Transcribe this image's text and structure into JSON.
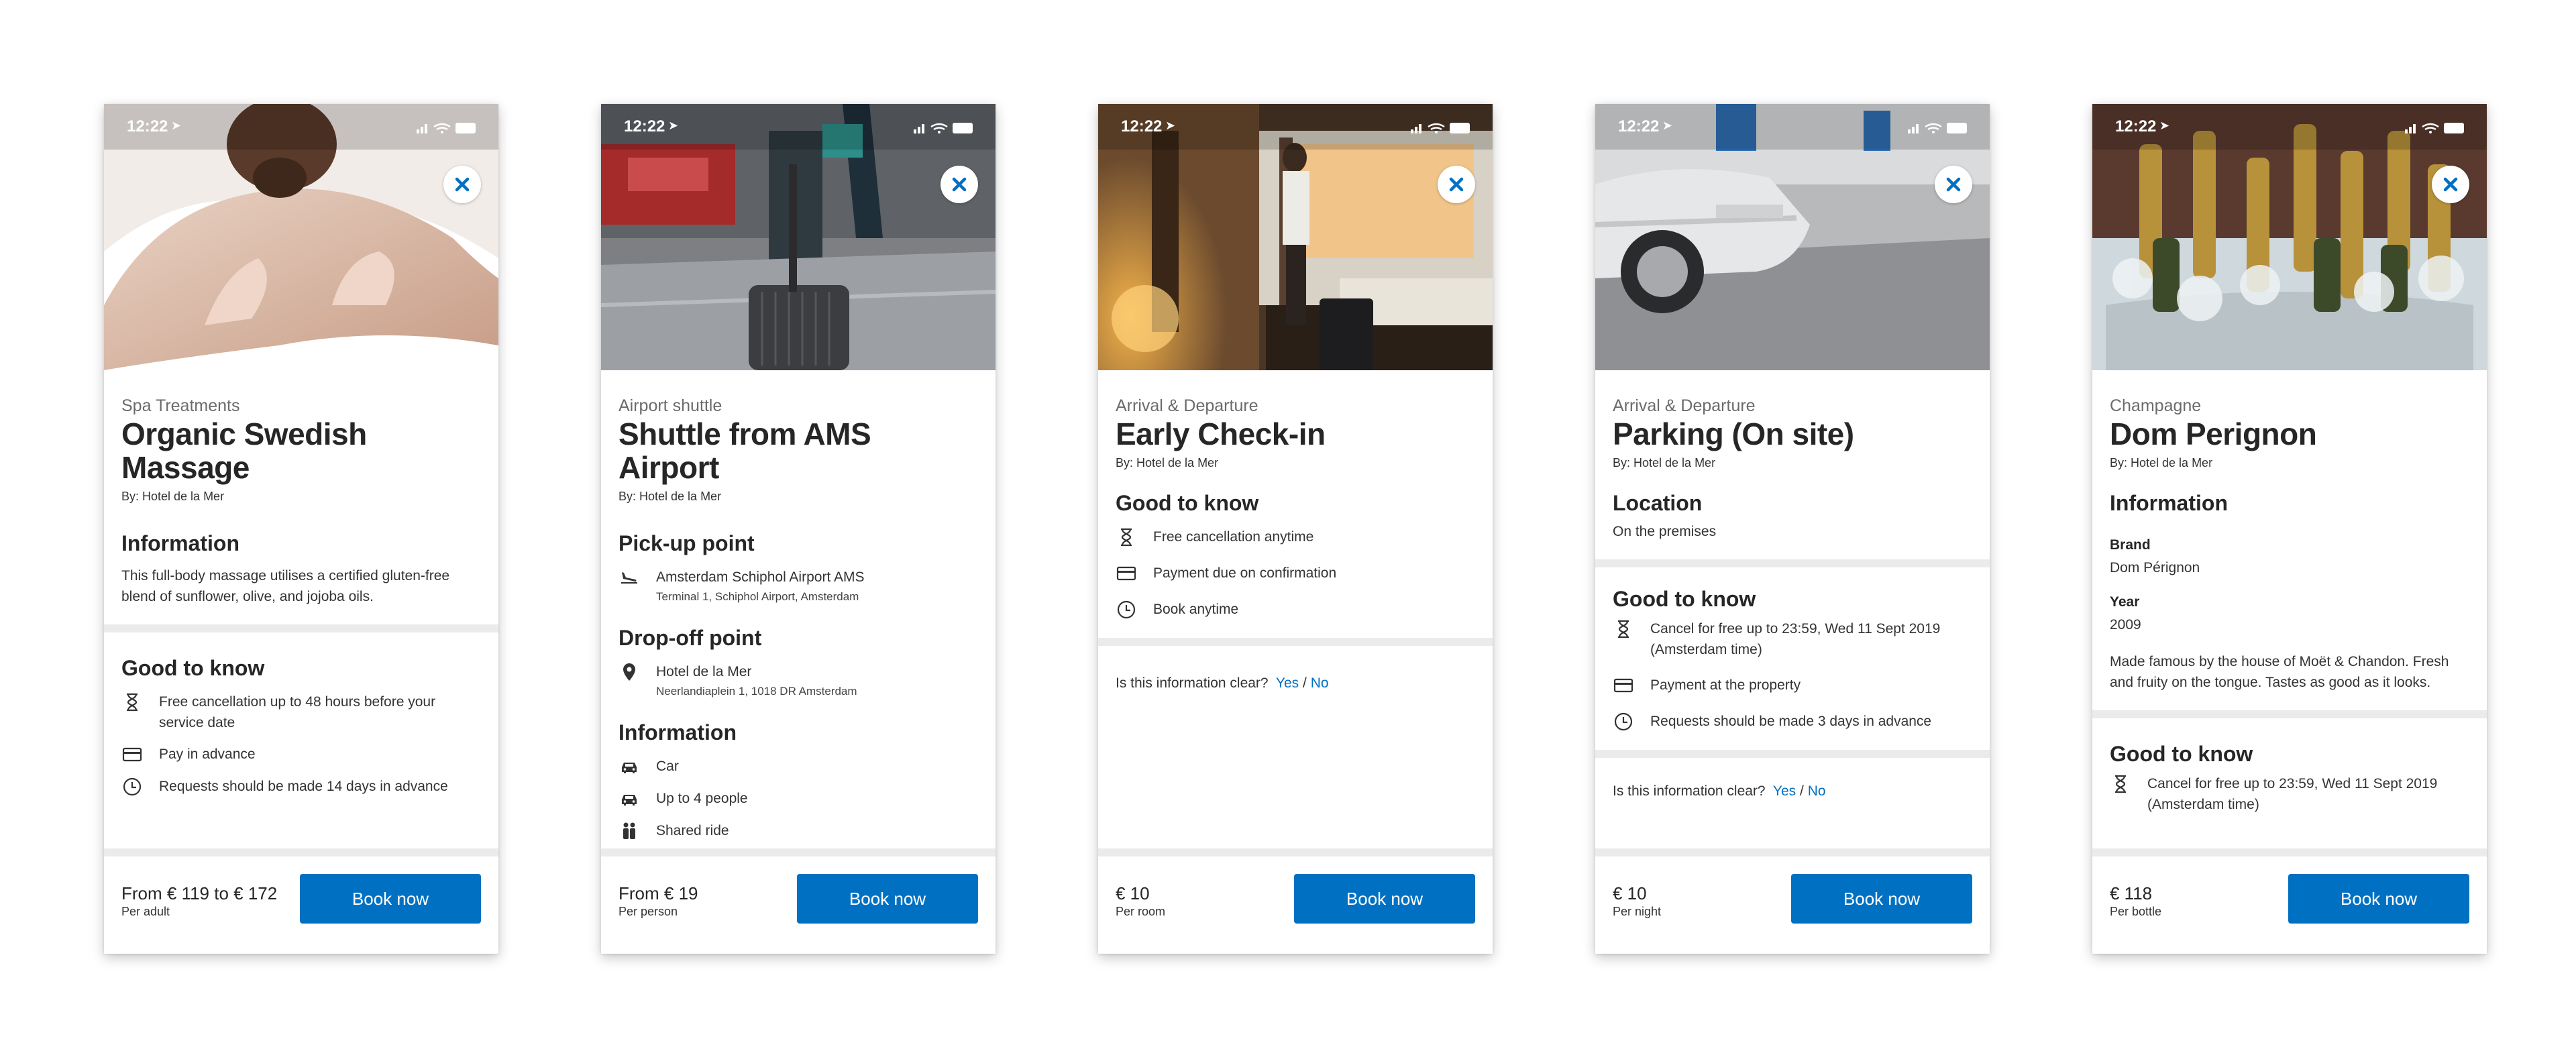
{
  "status_bar": {
    "time": "12:22"
  },
  "colors": {
    "primary": "#0071c2",
    "divider": "#ebebeb",
    "text": "#262626"
  },
  "screens": [
    {
      "category": "Spa Treatments",
      "title_line1": "Organic Swedish",
      "title_line2": "Massage",
      "by": "By: Hotel de la Mer",
      "info_heading": "Information",
      "info_text": "This full-body massage utilises a certified gluten-free blend of sunflower, olive, and jojoba oils.",
      "gtk_heading": "Good to know",
      "gtk": [
        {
          "icon": "hourglass-icon",
          "text": "Free cancellation up to 48 hours before your service date"
        },
        {
          "icon": "credit-card-icon",
          "text": "Pay in advance"
        },
        {
          "icon": "clock-icon",
          "text": "Requests should be made 14 days in advance"
        }
      ],
      "price": "From € 119 to € 172",
      "per": "Per adult",
      "button": "Book now"
    },
    {
      "category": "Airport shuttle",
      "title_line1": "Shuttle from AMS",
      "title_line2": "Airport",
      "by": "By: Hotel de la Mer",
      "pickup_heading": "Pick-up point",
      "pickup": {
        "icon": "airplane-landing-icon",
        "text": "Amsterdam Schiphol Airport AMS",
        "sub": "Terminal 1, Schiphol Airport, Amsterdam"
      },
      "dropoff_heading": "Drop-off point",
      "dropoff": {
        "icon": "map-pin-icon",
        "text": "Hotel de la Mer",
        "sub": "Neerlandiaplein 1, 1018 DR Amsterdam"
      },
      "info_heading": "Information",
      "info": [
        {
          "icon": "car-icon",
          "text": "Car"
        },
        {
          "icon": "car-icon",
          "text": "Up to 4 people"
        },
        {
          "icon": "people-icon",
          "text": "Shared ride"
        }
      ],
      "price": "From € 19",
      "per": "Per person",
      "button": "Book now"
    },
    {
      "category": "Arrival & Departure",
      "title_line1": "Early Check-in",
      "by": "By: Hotel de la Mer",
      "gtk_heading": "Good to know",
      "gtk": [
        {
          "icon": "hourglass-icon",
          "text": "Free cancellation anytime"
        },
        {
          "icon": "credit-card-icon",
          "text": "Payment due on confirmation"
        },
        {
          "icon": "clock-icon",
          "text": "Book anytime"
        }
      ],
      "clear_q": "Is this information clear?",
      "yes": "Yes",
      "slash": "/",
      "no": "No",
      "price": "€ 10",
      "per": "Per room",
      "button": "Book now"
    },
    {
      "category": "Arrival & Departure",
      "title_line1": "Parking (On site)",
      "by": "By: Hotel de la Mer",
      "loc_heading": "Location",
      "loc_text": "On the premises",
      "gtk_heading": "Good to know",
      "gtk": [
        {
          "icon": "hourglass-icon",
          "text": "Cancel for free up to 23:59, Wed 11 Sept 2019 (Amsterdam time)"
        },
        {
          "icon": "credit-card-icon",
          "text": "Payment at the property"
        },
        {
          "icon": "clock-icon",
          "text": "Requests should be made 3 days in advance"
        }
      ],
      "clear_q": "Is this information clear?",
      "yes": "Yes",
      "slash": "/",
      "no": "No",
      "price": "€ 10",
      "per": "Per night",
      "button": "Book now"
    },
    {
      "category": "Champagne",
      "title_line1": "Dom Perignon",
      "by": "By: Hotel de la Mer",
      "info_heading": "Information",
      "brand_label": "Brand",
      "brand_value": "Dom Pérignon",
      "year_label": "Year",
      "year_value": "2009",
      "info_text": "Made famous by the house of Moët & Chandon. Fresh and fruity on the tongue. Tastes as good as it looks.",
      "gtk_heading": "Good to know",
      "gtk": [
        {
          "icon": "hourglass-icon",
          "text": "Cancel for free up to 23:59, Wed 11 Sept 2019 (Amsterdam time)"
        }
      ],
      "price": "€ 118",
      "per": "Per bottle",
      "button": "Book now"
    }
  ]
}
